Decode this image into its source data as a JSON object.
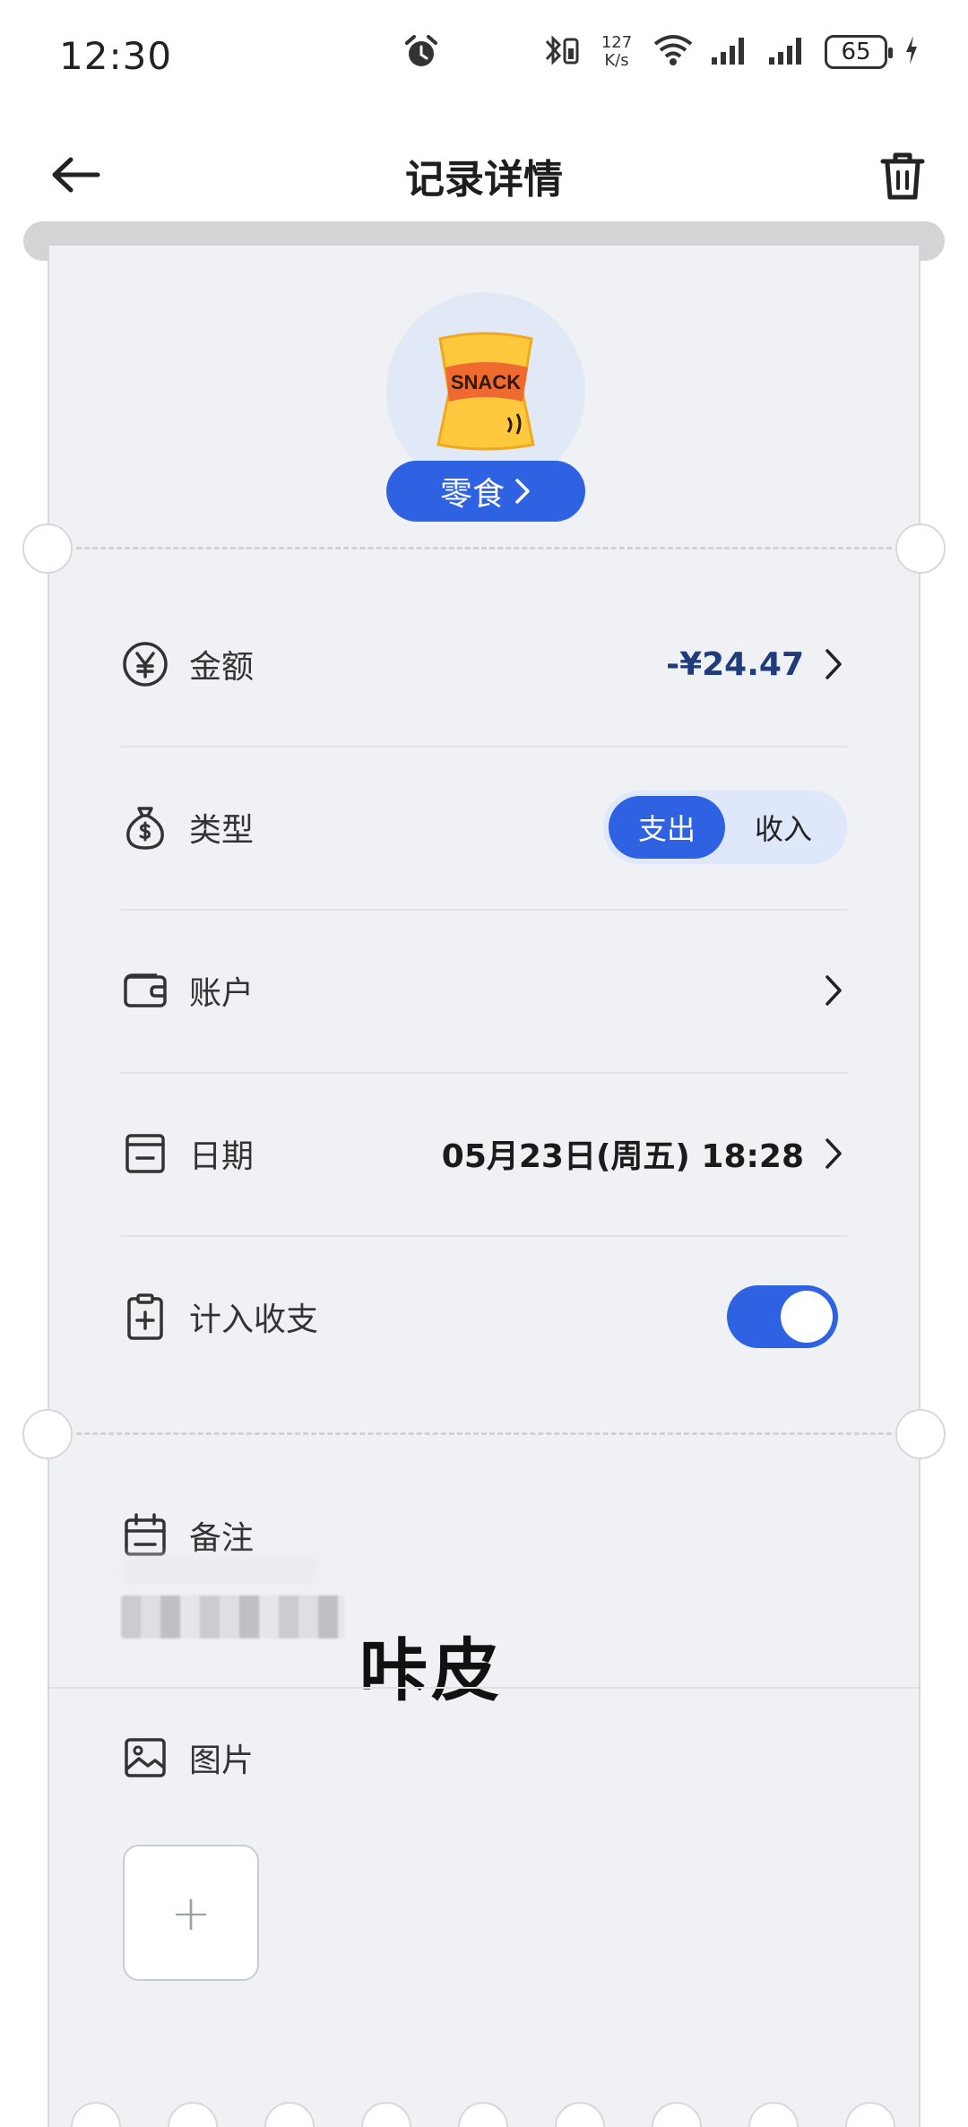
{
  "status_bar": {
    "time": "12:30",
    "net_speed_top": "127",
    "net_speed_bottom": "K/s",
    "battery": "65"
  },
  "header": {
    "title": "记录详情"
  },
  "category": {
    "name": "零食",
    "icon_text": "SNACK"
  },
  "fields": {
    "amount": {
      "label": "金额",
      "value": "-¥24.47"
    },
    "type": {
      "label": "类型",
      "options": [
        "支出",
        "收入"
      ],
      "selected": "支出"
    },
    "account": {
      "label": "账户"
    },
    "date": {
      "label": "日期",
      "value": "05月23日(周五) 18:28"
    },
    "include": {
      "label": "计入收支",
      "enabled": true
    }
  },
  "note": {
    "label": "备注",
    "overlay_text": "咔皮"
  },
  "images": {
    "label": "图片",
    "add_symbol": "+"
  },
  "colors": {
    "accent": "#2e62e2",
    "amount": "#1f3c7c",
    "card_bg": "#eff1f4"
  }
}
